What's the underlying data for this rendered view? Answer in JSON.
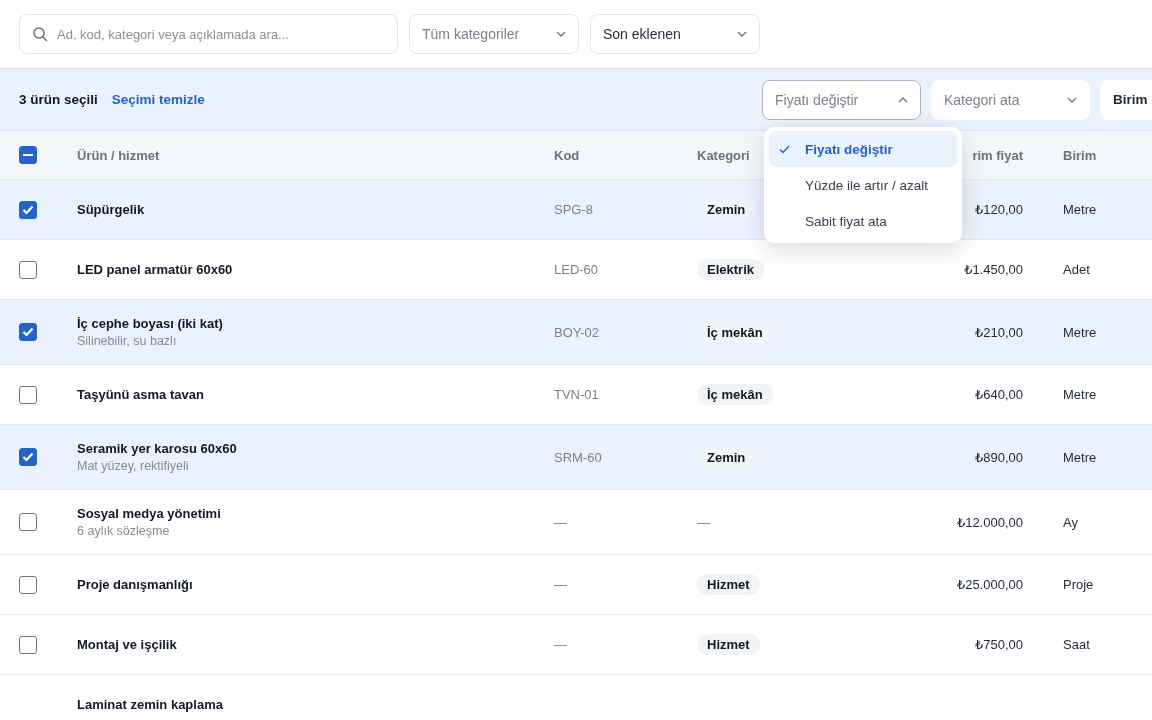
{
  "search": {
    "placeholder": "Ad, kod, kategori veya açıklamada ara..."
  },
  "filters": [
    {
      "label": "Tüm kategoriler",
      "kind": "placeholder"
    },
    {
      "label": "Son eklenen",
      "kind": "value"
    }
  ],
  "selection_bar": {
    "count_text": "3 ürün seçili",
    "clear_link": "Seçimi temizle",
    "actions": [
      {
        "label": "Fiyatı değiştir",
        "kind": "placeholder",
        "expanded": true,
        "chevron": true
      },
      {
        "label": "Kategori ata",
        "kind": "placeholder",
        "expanded": false,
        "chevron": true
      },
      {
        "label": "Birim",
        "kind": "value",
        "expanded": false,
        "chevron": false
      }
    ]
  },
  "price_menu": {
    "items": [
      {
        "label": "Fiyatı değiştir",
        "selected": true
      },
      {
        "label": "Yüzde ile artır / azalt",
        "selected": false
      },
      {
        "label": "Sabit fiyat ata",
        "selected": false
      }
    ]
  },
  "table": {
    "select_all": {
      "indeterminate": true
    },
    "columns": [
      {
        "label": "Ürün / hizmet"
      },
      {
        "label": "Kod"
      },
      {
        "label": "Kategori"
      },
      {
        "label": "rim fiyat"
      },
      {
        "label": "Birim"
      }
    ],
    "rows": [
      {
        "name": "Süpürgelik",
        "code": "SPG-8",
        "category": {
          "kind": "pill",
          "label": "Zemin"
        },
        "price": "₺120,00",
        "unit": "Metre",
        "selected": true
      },
      {
        "name": "LED panel armatür 60x60",
        "code": "LED-60",
        "category": {
          "kind": "pill",
          "label": "Elektrik"
        },
        "price": "₺1.450,00",
        "unit": "Adet",
        "selected": false
      },
      {
        "name": "İç cephe boyası (iki kat)",
        "note": "Silinebilir, su bazlı",
        "code": "BOY-02",
        "category": {
          "kind": "pill",
          "label": "İç mekân"
        },
        "price": "₺210,00",
        "unit": "Metre",
        "selected": true
      },
      {
        "name": "Taşyünü asma tavan",
        "code": "TVN-01",
        "category": {
          "kind": "pill",
          "label": "İç mekân"
        },
        "price": "₺640,00",
        "unit": "Metre",
        "selected": false
      },
      {
        "name": "Seramik yer karosu 60x60",
        "note": "Mat yüzey, rektifiyeli",
        "code": "SRM-60",
        "category": {
          "kind": "pill",
          "label": "Zemin"
        },
        "price": "₺890,00",
        "unit": "Metre",
        "selected": true
      },
      {
        "name": "Sosyal medya yönetimi",
        "note": "6 aylık sözleşme",
        "code": "—",
        "category": {
          "kind": "plain",
          "label": "—"
        },
        "price": "₺12.000,00",
        "unit": "Ay",
        "selected": false
      },
      {
        "name": "Proje danışmanlığı",
        "code": "—",
        "category": {
          "kind": "pill",
          "label": "Hizmet"
        },
        "price": "₺25.000,00",
        "unit": "Proje",
        "selected": false
      },
      {
        "name": "Montaj ve işçilik",
        "code": "—",
        "category": {
          "kind": "pill",
          "label": "Hizmet"
        },
        "price": "₺750,00",
        "unit": "Saat",
        "selected": false
      },
      {
        "name": "Laminat zemin kaplama"
      }
    ]
  }
}
